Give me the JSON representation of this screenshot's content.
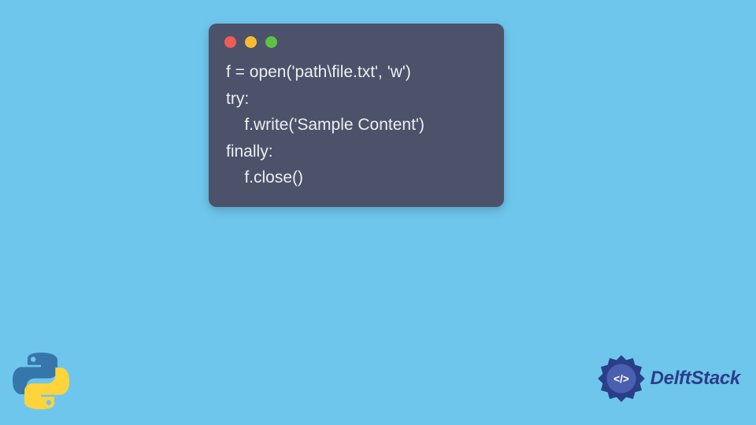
{
  "window_controls": {
    "red": "#ee5c55",
    "yellow": "#f6bb33",
    "green": "#5dc242"
  },
  "code_lines": [
    "f = open('path\\file.txt', 'w')",
    "try:",
    "    f.write('Sample Content')",
    "finally:",
    "    f.close()"
  ],
  "brand": {
    "name": "DelftStack"
  },
  "colors": {
    "background": "#6ec6ed",
    "code_bg": "#4b5269",
    "code_fg": "#eceff4",
    "brand_color": "#2b3e88"
  }
}
